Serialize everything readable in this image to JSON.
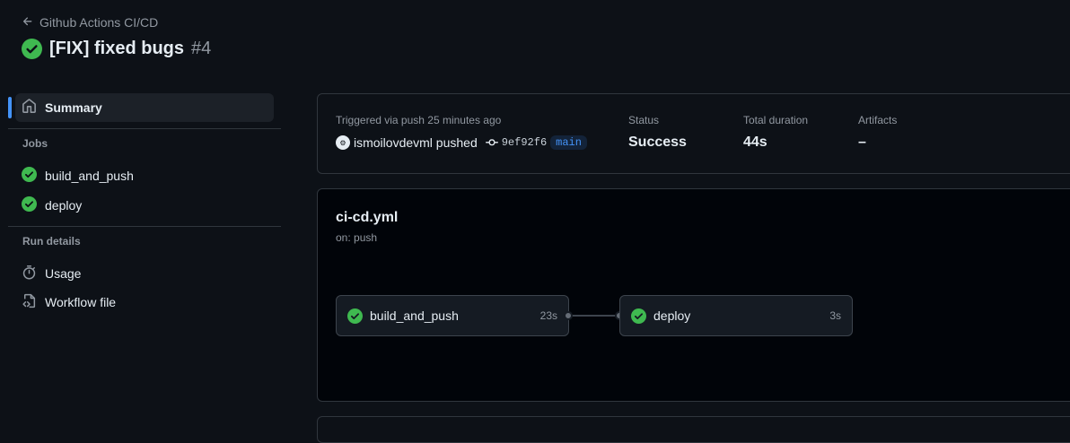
{
  "header": {
    "back_label": "Github Actions CI/CD",
    "run_title": "[FIX] fixed bugs",
    "run_number": "#4"
  },
  "sidebar": {
    "summary_label": "Summary",
    "jobs_heading": "Jobs",
    "jobs": [
      {
        "label": "build_and_push",
        "status": "success"
      },
      {
        "label": "deploy",
        "status": "success"
      }
    ],
    "run_details_heading": "Run details",
    "usage_label": "Usage",
    "workflow_file_label": "Workflow file"
  },
  "summary": {
    "triggered_text": "Triggered via push 25 minutes ago",
    "actor": "ismoilovdevml pushed",
    "commit_sha": "9ef92f6",
    "branch": "main",
    "status_label": "Status",
    "status_value": "Success",
    "duration_label": "Total duration",
    "duration_value": "44s",
    "artifacts_label": "Artifacts",
    "artifacts_value": "–"
  },
  "graph": {
    "workflow_name": "ci-cd.yml",
    "trigger": "on: push",
    "jobs": [
      {
        "name": "build_and_push",
        "duration": "23s"
      },
      {
        "name": "deploy",
        "duration": "3s"
      }
    ]
  },
  "colors": {
    "success": "#3fb950",
    "accent": "#4493f8",
    "background": "#0d1117"
  },
  "icons": {
    "back": "arrow-left-icon",
    "status": "check-circle-icon",
    "summary": "home-icon",
    "usage": "stopwatch-icon",
    "workflow_file": "file-code-icon",
    "commit": "git-commit-icon"
  }
}
